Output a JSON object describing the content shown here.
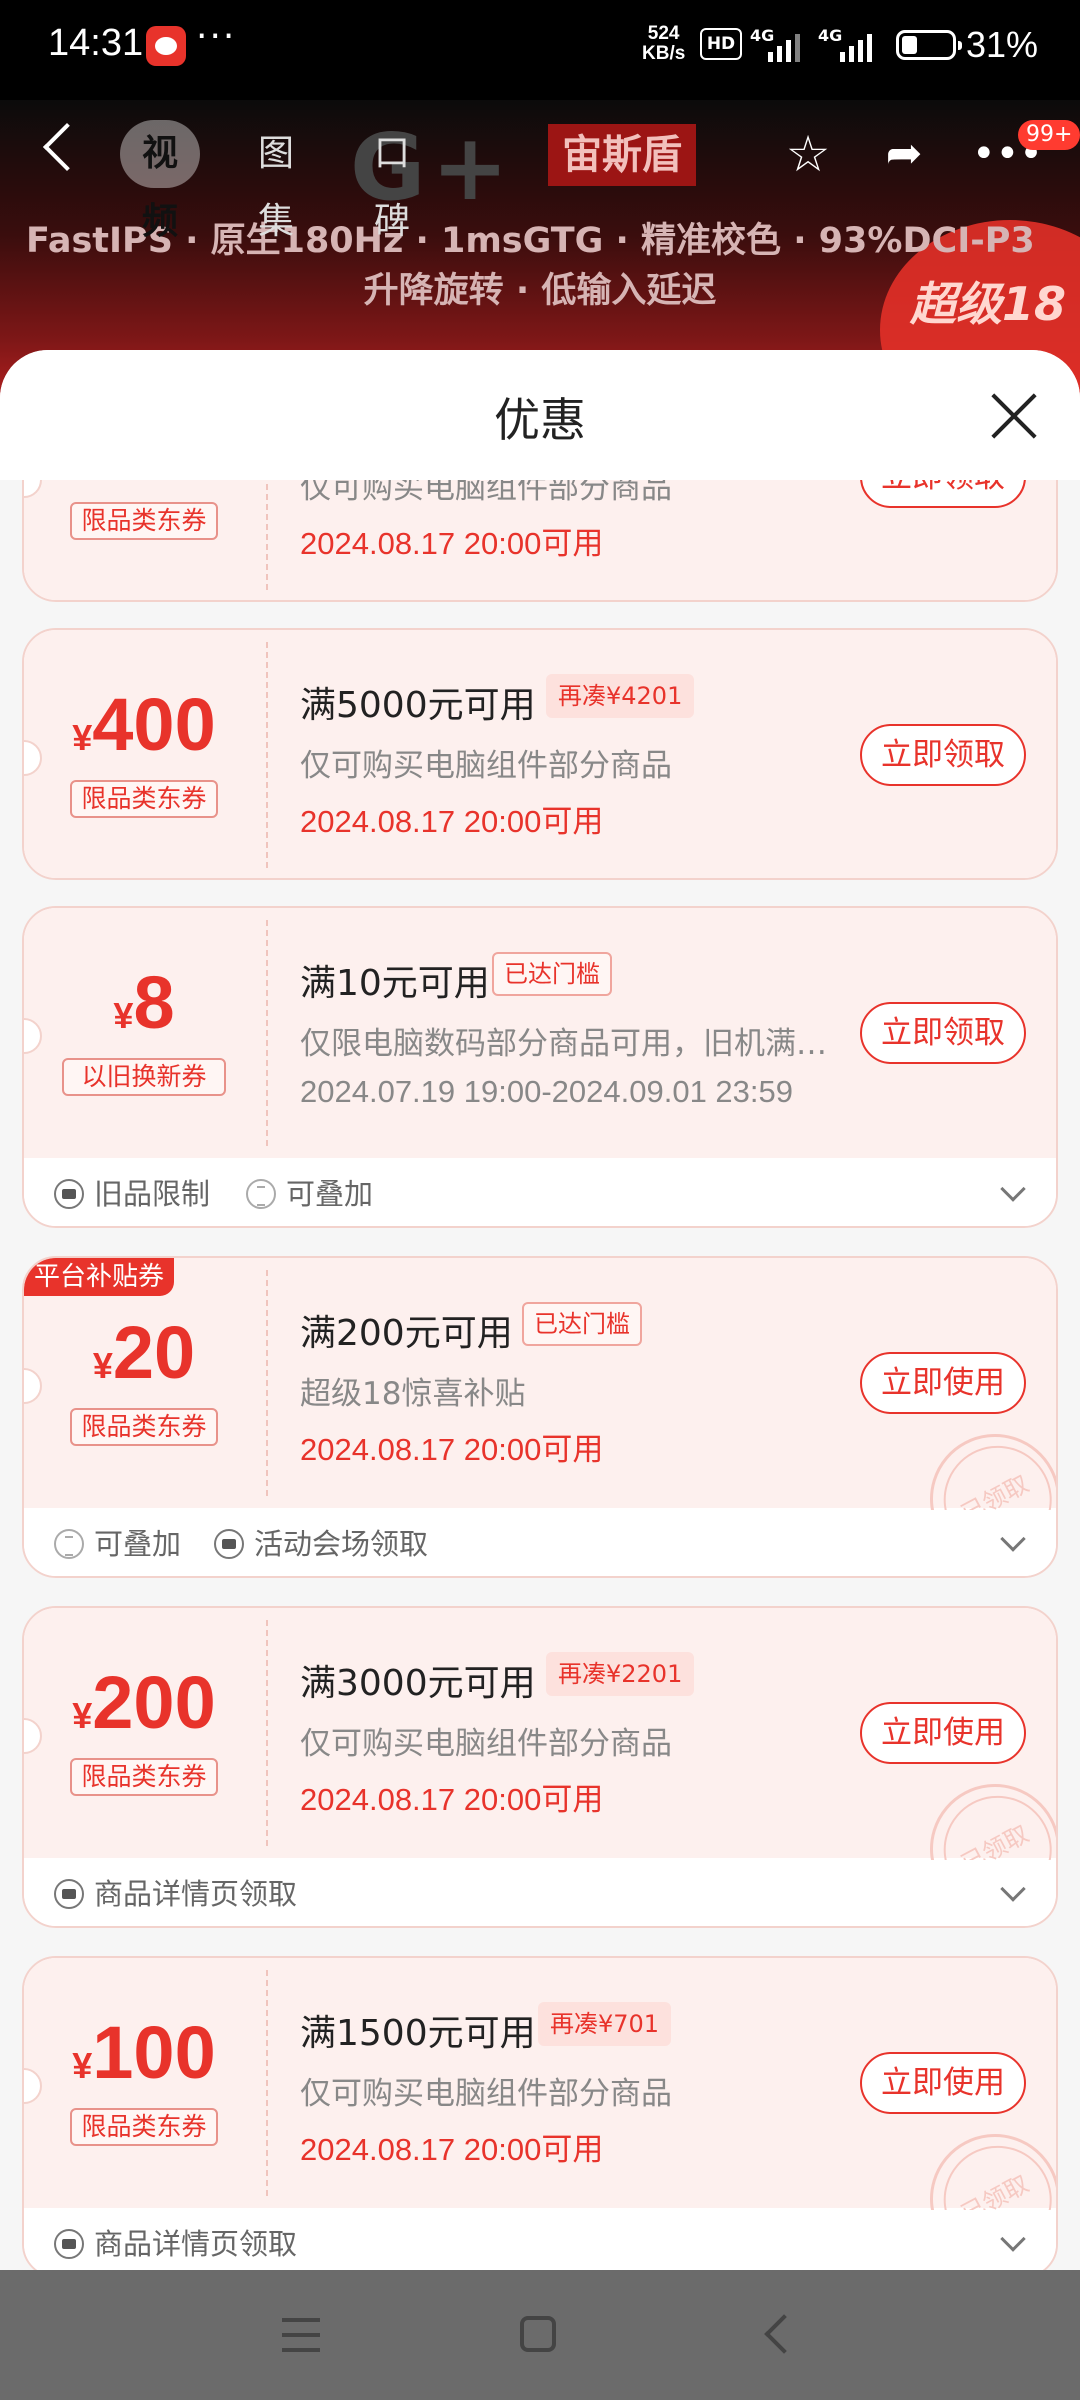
{
  "status_bar": {
    "time": "14:31",
    "more": "···",
    "speed_value": "524",
    "speed_unit": "KB/s",
    "hd": "HD",
    "net1": "4G",
    "net2": "4G",
    "battery_level": 0.31,
    "battery_pct": "31%"
  },
  "header": {
    "tabs": [
      {
        "label": "视频",
        "active": true
      },
      {
        "label": "图集",
        "active": false
      },
      {
        "label": "口碑",
        "active": false
      }
    ],
    "brand_logo": "G+",
    "brand_name": "宙斯盾",
    "spec_line1": "FastIPS · 原生180Hz · 1msGTG · 精准校色 · 93%DCI-P3",
    "spec_line2": "升降旋转 · 低输入延迟",
    "promo": "超级18",
    "badge": "99+"
  },
  "sheet": {
    "title": "优惠"
  },
  "coupons": [
    {
      "amount": "",
      "yen": "¥",
      "type": "限品类东券",
      "condition": "",
      "tag": "",
      "desc": "仅可购买电脑组件部分商品",
      "time": "2024.08.17 20:00可用",
      "button": "立即领取"
    },
    {
      "amount": "400",
      "yen": "¥",
      "type": "限品类东券",
      "condition": "满5000元可用",
      "tag": "再凑¥4201",
      "desc": "仅可购买电脑组件部分商品",
      "time": "2024.08.17 20:00可用",
      "button": "立即领取"
    },
    {
      "amount": "8",
      "yen": "¥",
      "type": "以旧换新券",
      "condition": "满10元可用",
      "tag": "已达门槛",
      "desc": "仅限电脑数码部分商品可用，旧机满…",
      "time": "2024.07.19 19:00-2024.09.01 23:59",
      "button": "立即领取",
      "footer": [
        "旧品限制",
        "可叠加"
      ]
    },
    {
      "corner": "平台补贴券",
      "amount": "20",
      "yen": "¥",
      "type": "限品类东券",
      "condition": "满200元可用",
      "tag": "已达门槛",
      "desc": "超级18惊喜补贴",
      "time": "2024.08.17 20:00可用",
      "button": "立即使用",
      "stamp": "已领取",
      "footer": [
        "可叠加",
        "活动会场领取"
      ]
    },
    {
      "amount": "200",
      "yen": "¥",
      "type": "限品类东券",
      "condition": "满3000元可用",
      "tag": "再凑¥2201",
      "desc": "仅可购买电脑组件部分商品",
      "time": "2024.08.17 20:00可用",
      "button": "立即使用",
      "stamp": "已领取",
      "footer": [
        "商品详情页领取"
      ]
    },
    {
      "amount": "100",
      "yen": "¥",
      "type": "限品类东券",
      "condition": "满1500元可用",
      "tag": "再凑¥701",
      "desc": "仅可购买电脑组件部分商品",
      "time": "2024.08.17 20:00可用",
      "button": "立即使用",
      "stamp": "已领取",
      "footer": [
        "商品详情页领取"
      ]
    }
  ],
  "icons": {
    "back": "back-arrow-icon",
    "favorite": "star-icon",
    "share": "share-icon",
    "more": "more-icon",
    "close": "close-icon"
  },
  "colors": {
    "accent": "#e8332b",
    "coupon_bg": "#fdf0ee",
    "sheet_bg": "#f6f6f6"
  }
}
